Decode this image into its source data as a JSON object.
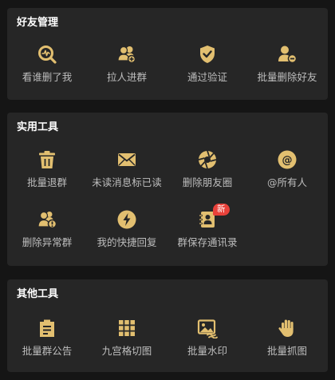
{
  "colors": {
    "background": "#151515",
    "card": "#262626",
    "icon_gold": "#e2bf70",
    "label": "#bdbdbd",
    "title": "#ffffff",
    "badge": "#e8413a"
  },
  "sections": [
    {
      "title": "好友管理",
      "items": [
        {
          "label": "看谁删了我",
          "icon": "magnifier-pulse-icon"
        },
        {
          "label": "拉人进群",
          "icon": "add-user-icon"
        },
        {
          "label": "通过验证",
          "icon": "shield-check-icon"
        },
        {
          "label": "批量删除好友",
          "icon": "remove-user-icon"
        }
      ]
    },
    {
      "title": "实用工具",
      "items": [
        {
          "label": "批量退群",
          "icon": "trash-icon"
        },
        {
          "label": "未读消息标已读",
          "icon": "envelope-icon"
        },
        {
          "label": "删除朋友圈",
          "icon": "aperture-icon"
        },
        {
          "label": "@所有人",
          "icon": "at-sign-icon"
        },
        {
          "label": "删除异常群",
          "icon": "group-alert-icon"
        },
        {
          "label": "我的快捷回复",
          "icon": "lightning-icon"
        },
        {
          "label": "群保存通讯录",
          "icon": "contact-book-icon",
          "badge": "新"
        }
      ]
    },
    {
      "title": "其他工具",
      "items": [
        {
          "label": "批量群公告",
          "icon": "notice-board-icon"
        },
        {
          "label": "九宫格切图",
          "icon": "grid-icon"
        },
        {
          "label": "批量水印",
          "icon": "image-watermark-icon"
        },
        {
          "label": "批量抓图",
          "icon": "hand-grab-icon"
        }
      ]
    }
  ]
}
